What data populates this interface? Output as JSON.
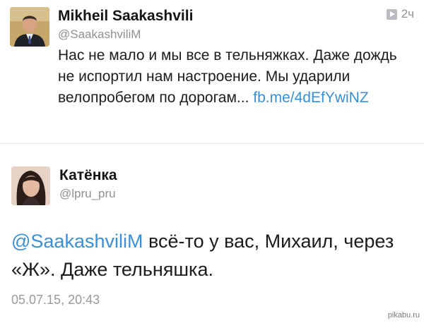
{
  "tweet1": {
    "author_name": "Mikheil Saakashvili",
    "handle": "@SaakashviliM",
    "timestamp": "2ч",
    "timestamp_icon": "play-icon",
    "text": "Нас не мало и мы все в тельняжках. Даже дождь не испортил нам настроение. Мы ударили велопробегом по дорогам...",
    "link": "fb.me/4dEfYwiNZ",
    "link_color": "#3a8fd8"
  },
  "tweet2": {
    "author_name": "Катёнка",
    "handle": "@lpru_pru",
    "mention": "@SaakashviliM",
    "text": "всё-то у вас, Михаил, через «Ж». Даже тельняшка.",
    "date": "05.07.15, 20:43"
  },
  "watermark": "pikabu.ru"
}
